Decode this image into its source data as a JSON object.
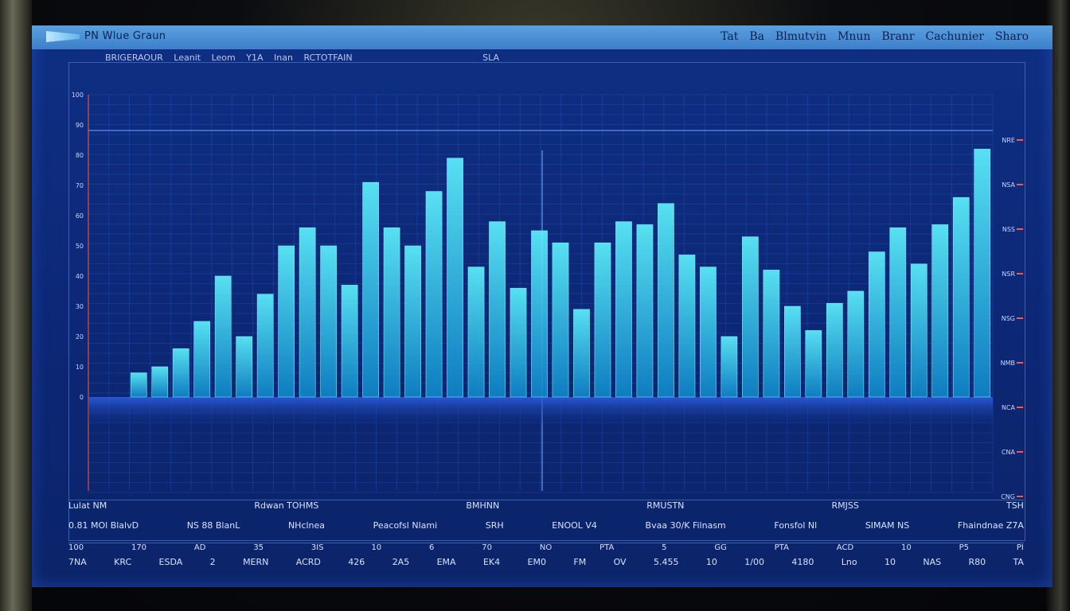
{
  "app": {
    "title": "PN Wlue Graun"
  },
  "menu": [
    "Tat",
    "Ba",
    "Blmutvin",
    "Mnun",
    "Branr",
    "Cachunier",
    "Sharo"
  ],
  "header_row": [
    "BRIGERAOUR",
    "Leanit",
    "Leom",
    "Y1A",
    "Inan",
    "RCTOTFAIN",
    "SLA"
  ],
  "chart_data": {
    "type": "bar",
    "title": "",
    "xlabel": "",
    "ylabel": "",
    "ylim": [
      0,
      100
    ],
    "grid": true,
    "y_ticks": [
      "100",
      "90",
      "80",
      "70",
      "60",
      "50",
      "40",
      "30",
      "20",
      "10",
      "0"
    ],
    "series": [
      {
        "values": [
          8,
          10,
          16,
          25,
          40,
          20,
          34,
          50,
          56,
          50,
          37,
          71,
          56,
          50,
          68,
          79,
          43,
          58,
          36,
          55,
          51,
          29,
          51,
          58,
          57,
          64,
          47,
          43,
          20,
          53,
          42,
          30,
          22,
          31,
          35,
          48,
          56,
          44,
          57,
          66,
          82
        ]
      }
    ],
    "colors": {
      "bar_top": "#5ff4ff",
      "bar_bottom": "#0f86c9",
      "grid": "#2e5ed0",
      "accent": "#ff5a3c"
    }
  },
  "right_axis": [
    "NRE",
    "NSA",
    "NSS",
    "NSR",
    "NSG",
    "NMB",
    "NCA",
    "CNA",
    "CNG"
  ],
  "table_rows": [
    [
      "Lulat NM",
      "Rdwan TOHMS",
      "BMHNN",
      "RMUSTN",
      "RMJSS",
      "TSH"
    ],
    [
      "0.81 MOl BlalvD",
      "NS 88 BlanL",
      "NHclnea",
      "Peacofsl Nlami",
      "SRH",
      "ENOOL V4",
      "Bvaa 30/K Filnasm",
      "Fonsfol Nl",
      "SIMAM NS",
      "Fhaindnae Z7A"
    ],
    [
      "100",
      "170",
      "AD",
      "35",
      "3IS",
      "10",
      "6",
      "70",
      "NO",
      "PTA",
      "5",
      "GG",
      "PTA",
      "ACD",
      "10",
      "P5",
      "PI"
    ],
    [
      "7NA",
      "KRC",
      "ESDA",
      "2",
      "MERN",
      "ACRD",
      "426",
      "2A5",
      "EMA",
      "EK4",
      "EM0",
      "FM",
      "OV",
      "5.455",
      "10",
      "1/00",
      "4180",
      "Lno",
      "10",
      "NAS",
      "R80",
      "TA"
    ]
  ]
}
